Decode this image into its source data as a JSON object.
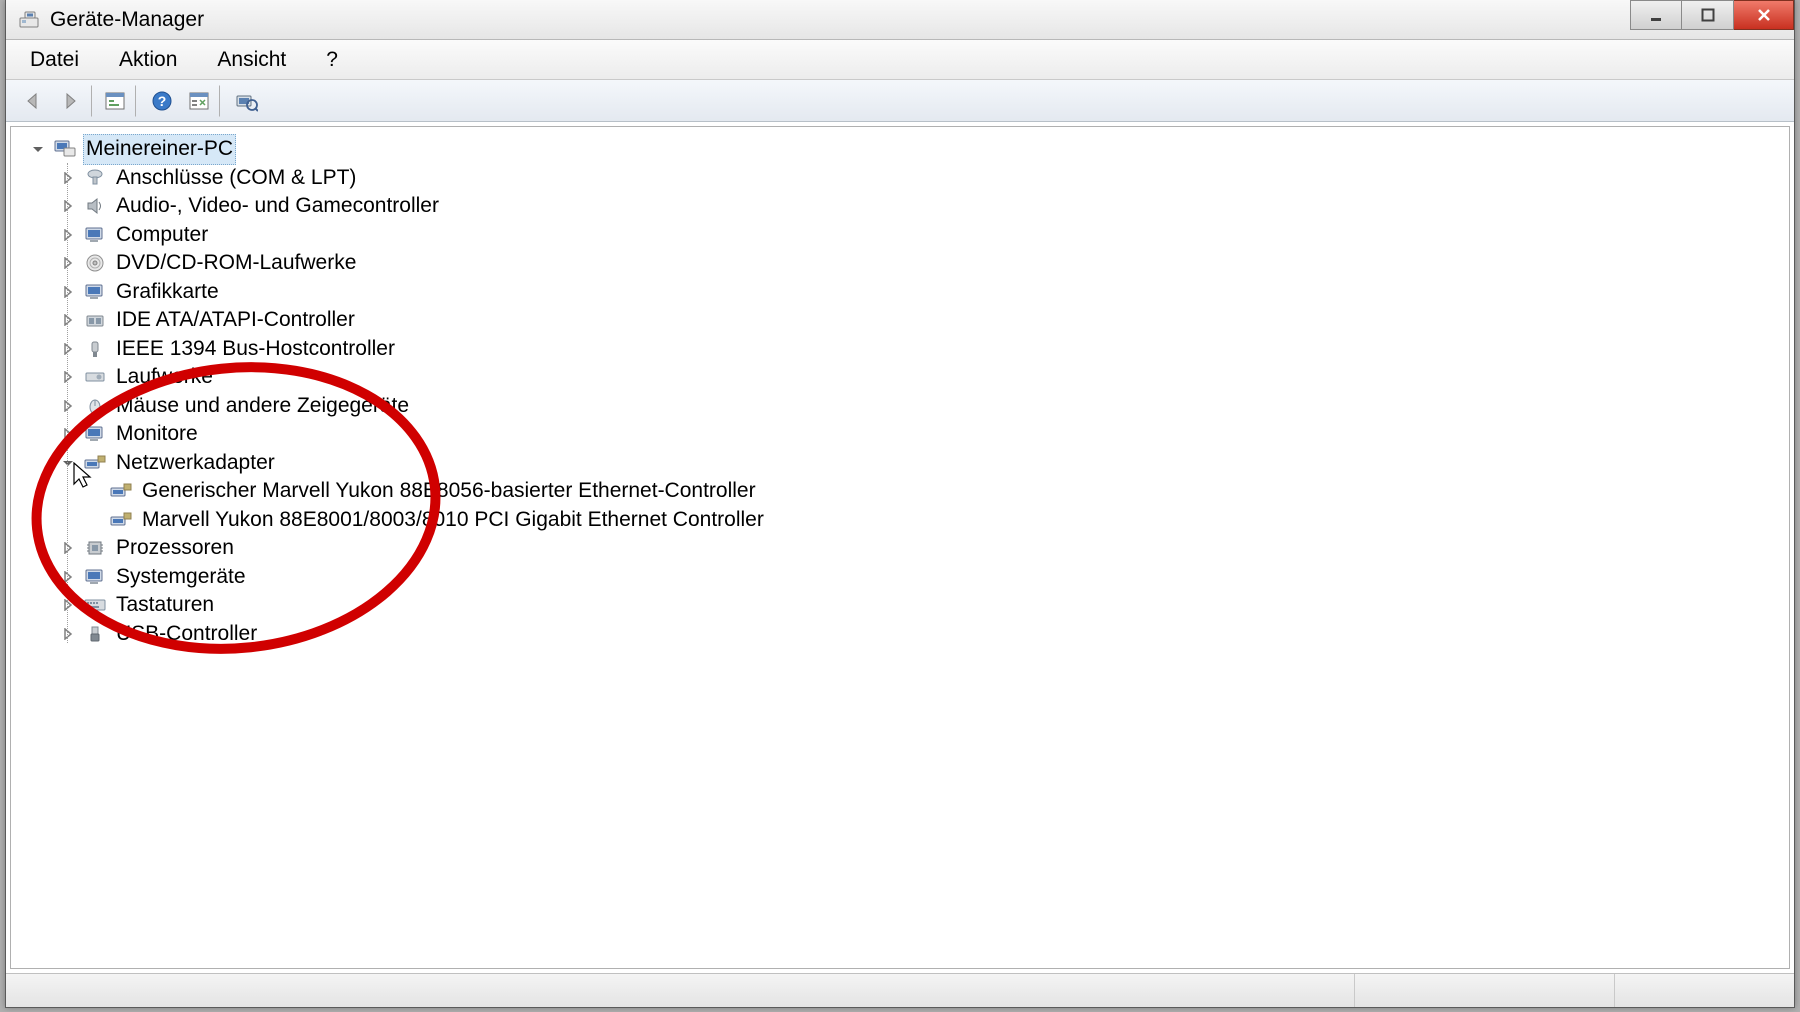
{
  "window": {
    "title": "Geräte-Manager"
  },
  "menu": {
    "file": "Datei",
    "action": "Aktion",
    "view": "Ansicht",
    "help": "?"
  },
  "tree": {
    "root": "Meinereiner-PC",
    "categories": [
      {
        "label": "Anschlüsse (COM & LPT)"
      },
      {
        "label": "Audio-, Video- und Gamecontroller"
      },
      {
        "label": "Computer"
      },
      {
        "label": "DVD/CD-ROM-Laufwerke"
      },
      {
        "label": "Grafikkarte"
      },
      {
        "label": "IDE ATA/ATAPI-Controller"
      },
      {
        "label": "IEEE 1394 Bus-Hostcontroller"
      },
      {
        "label": "Laufwerke"
      },
      {
        "label": "Mäuse und andere Zeigegeräte"
      },
      {
        "label": "Monitore"
      },
      {
        "label": "Netzwerkadapter",
        "expanded": true,
        "children": [
          {
            "label": "Generischer Marvell Yukon 88E8056-basierter Ethernet-Controller"
          },
          {
            "label": "Marvell Yukon 88E8001/8003/8010 PCI Gigabit Ethernet Controller"
          }
        ]
      },
      {
        "label": "Prozessoren"
      },
      {
        "label": "Systemgeräte"
      },
      {
        "label": "Tastaturen"
      },
      {
        "label": "USB-Controller"
      }
    ]
  },
  "colors": {
    "annotation": "#d00000"
  }
}
